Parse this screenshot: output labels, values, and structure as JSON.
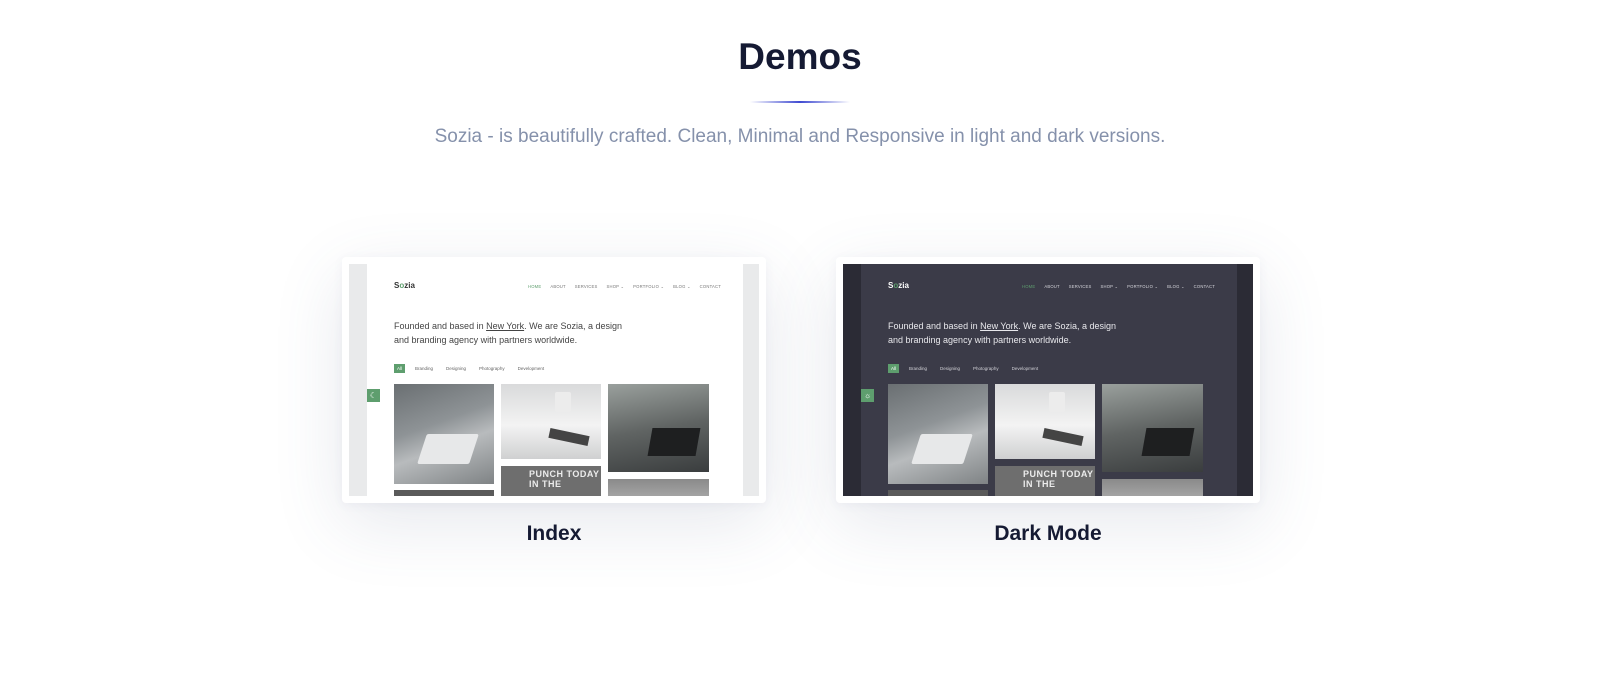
{
  "section": {
    "title": "Demos",
    "subtitle": "Sozia - is beautifully crafted. Clean, Minimal and Responsive in light and dark versions."
  },
  "preview": {
    "logo_prefix": "S",
    "logo_mark": "o",
    "logo_suffix": "zia",
    "nav": [
      "HOME",
      "ABOUT",
      "SERVICES",
      "SHOP ⌄",
      "PORTFOLIO ⌄",
      "BLOG ⌄",
      "CONTACT"
    ],
    "intro_before": "Founded and based in ",
    "intro_link": "New York",
    "intro_after": ". We are Sozia, a design and branding agency with partners worldwide.",
    "filters": [
      "All",
      "Branding",
      "Designing",
      "Photography",
      "Development"
    ],
    "thumb_text": "PUNCH TODAY IN THE",
    "toggle_icon": "moon-icon"
  },
  "demos": [
    {
      "label": "Index",
      "theme": "light"
    },
    {
      "label": "Dark Mode",
      "theme": "dark"
    }
  ],
  "colors": {
    "accent_green": "#5e9e6e",
    "title": "#151a33",
    "subtitle": "#8591ab",
    "underline": "#3f4ad1",
    "dark_bg": "#3b3b48"
  }
}
